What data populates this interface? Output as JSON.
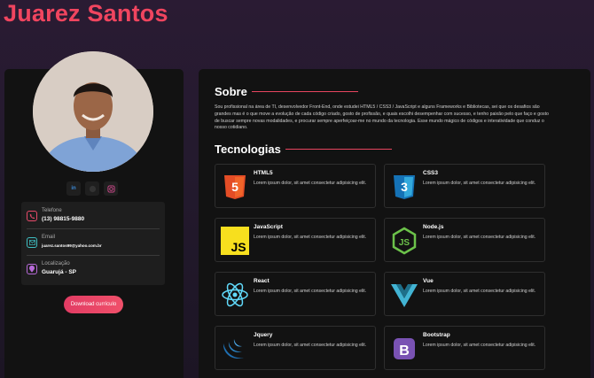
{
  "header": {
    "name": "Juarez Santos"
  },
  "profile": {
    "photo_desc": "avatar",
    "social": [
      {
        "icon": "linkedin-icon",
        "label": "in"
      },
      {
        "icon": "github-icon",
        "label": ""
      },
      {
        "icon": "instagram-icon",
        "label": ""
      }
    ],
    "contacts": [
      {
        "icon": "phone-icon",
        "label": "Telefone",
        "value": "(13) 98815-9880",
        "color": "#e84a6a"
      },
      {
        "icon": "email-icon",
        "label": "Email",
        "value": "juarez.santos99@yahoo.com.br",
        "color": "#3fbfc2"
      },
      {
        "icon": "location-icon",
        "label": "Localização",
        "value": "Guarujá - SP",
        "color": "#b86ad9"
      }
    ],
    "download_label": "Download currículo"
  },
  "about": {
    "title": "Sobre",
    "text": "Sou profissional na área de TI, desenvolvedor Front-End, onde estudei HTML5 / CSS3 / JavaScript e alguns Frameworks e Bibliotecas, sei que os desafios são grandes mas é o que move a evolução de cada código criado, gosto de profissão, e quais escolhi desempenhar com sucesso, e tenho paixão pelo que faço e gosto de buscar sempre novas modalidades, e procurar sempre aperfeiçoar-me no mundo da tecnologia. Esse mundo mágico de códigos e interatividade que conduz o nosso cotidiano."
  },
  "technologies": {
    "title": "Tecnologias",
    "items": [
      {
        "name": "HTML5",
        "icon": "html5-icon",
        "desc": "Lorem ipsum dolor, sit amet consectetur adipisicing elit."
      },
      {
        "name": "CSS3",
        "icon": "css3-icon",
        "desc": "Lorem ipsum dolor, sit amet consectetur adipisicing elit."
      },
      {
        "name": "JavaScript",
        "icon": "javascript-icon",
        "desc": "Lorem ipsum dolor, sit amet consectetur adipisicing elit."
      },
      {
        "name": "Node.js",
        "icon": "nodejs-icon",
        "desc": "Lorem ipsum dolor, sit amet consectetur adipisicing elit."
      },
      {
        "name": "React",
        "icon": "react-icon",
        "desc": "Lorem ipsum dolor, sit amet consectetur adipisicing elit."
      },
      {
        "name": "Vue",
        "icon": "vue-icon",
        "desc": "Lorem ipsum dolor, sit amet consectetur adipisicing elit."
      },
      {
        "name": "Jquery",
        "icon": "jquery-icon",
        "desc": "Lorem ipsum dolor, sit amet consectetur adipisicing elit."
      },
      {
        "name": "Bootstrap",
        "icon": "bootstrap-icon",
        "desc": "Lorem ipsum dolor, sit amet consectetur adipisicing elit."
      }
    ]
  },
  "colors": {
    "accent": "#f0455f",
    "card": "#121212",
    "background": "#241a2e"
  }
}
